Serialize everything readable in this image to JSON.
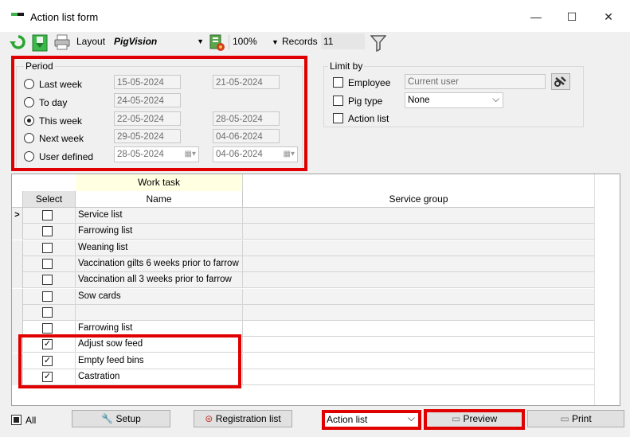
{
  "window": {
    "title": "Action list form",
    "minimize": "—",
    "maximize": "☐",
    "close": "✕"
  },
  "toolbar": {
    "layout_label": "Layout",
    "layout_value": "PigVision",
    "zoom": "100%",
    "records_label": "Records",
    "records_value": "11"
  },
  "period": {
    "title": "Period",
    "options": [
      {
        "label": "Last week",
        "from": "15-05-2024",
        "to": "21-05-2024",
        "selected": false
      },
      {
        "label": "To day",
        "from": "24-05-2024",
        "to": "",
        "selected": false
      },
      {
        "label": "This week",
        "from": "22-05-2024",
        "to": "28-05-2024",
        "selected": true
      },
      {
        "label": "Next week",
        "from": "29-05-2024",
        "to": "04-06-2024",
        "selected": false
      },
      {
        "label": "User defined",
        "from": "28-05-2024",
        "to": "04-06-2024",
        "selected": false
      }
    ]
  },
  "limit": {
    "title": "Limit by",
    "employee_label": "Employee",
    "employee_placeholder": "Current user",
    "pigtype_label": "Pig type",
    "pigtype_value": "None",
    "actionlist_label": "Action list"
  },
  "grid": {
    "band_header": "Work task",
    "col_select": "Select",
    "col_name": "Name",
    "col_service_group": "Service group",
    "current_row_marker": ">",
    "rows": [
      {
        "name": "Service list",
        "checked": false
      },
      {
        "name": "Farrowing list",
        "checked": false
      },
      {
        "name": "Weaning list",
        "checked": false
      },
      {
        "name": "Vaccination gilts 6 weeks prior to farrow",
        "checked": false
      },
      {
        "name": "Vaccination all 3 weeks prior to farrow",
        "checked": false
      },
      {
        "name": "Sow cards",
        "checked": false
      },
      {
        "name": "",
        "checked": false
      },
      {
        "name": "Farrowing list",
        "checked": false
      },
      {
        "name": "Adjust sow feed",
        "checked": true
      },
      {
        "name": "Empty feed bins",
        "checked": true
      },
      {
        "name": "Castration",
        "checked": true
      }
    ]
  },
  "footer": {
    "all_label": "All",
    "setup": "Setup",
    "registration": "Registration list",
    "action_select": "Action list",
    "preview": "Preview",
    "print": "Print"
  },
  "colors": {
    "highlight": "#e00000",
    "band": "#ffffe1",
    "accent_green": "#3cb44a"
  },
  "icons": [
    "refresh-icon",
    "save-icon",
    "print-icon",
    "export-icon",
    "filter-icon",
    "key-icon",
    "calendar-icon",
    "wrench-icon",
    "list-icon",
    "printer-icon"
  ]
}
